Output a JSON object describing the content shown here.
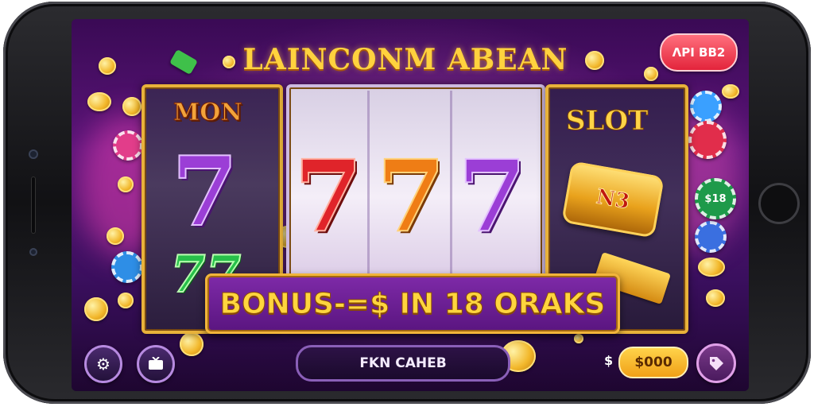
{
  "game": {
    "title": "LAINCONM ABEAN",
    "top_badge": "ΛΡΙ ΒΒ2",
    "reel_left_label": "MON",
    "reel_right_label": "SLOT",
    "gold_bar_text": "N3",
    "sevens": [
      "7",
      "7",
      "7",
      "7",
      "7",
      "77"
    ],
    "bonus_text": "BONUS-=$ IN 18 ORAKS",
    "spin_label": "FKN CAHEB",
    "currency_symbol": "$",
    "balance": "$000",
    "chip_label": "$18"
  },
  "colors": {
    "background": "#4a1168",
    "title_gold": "#ffd23e",
    "reel_frame": "#e8b23a",
    "badge_red": "#e3243b",
    "balance_gold": "#f0a017"
  },
  "icons": {
    "settings": "gear-icon",
    "tv": "tv-icon",
    "tag": "tag-icon"
  }
}
